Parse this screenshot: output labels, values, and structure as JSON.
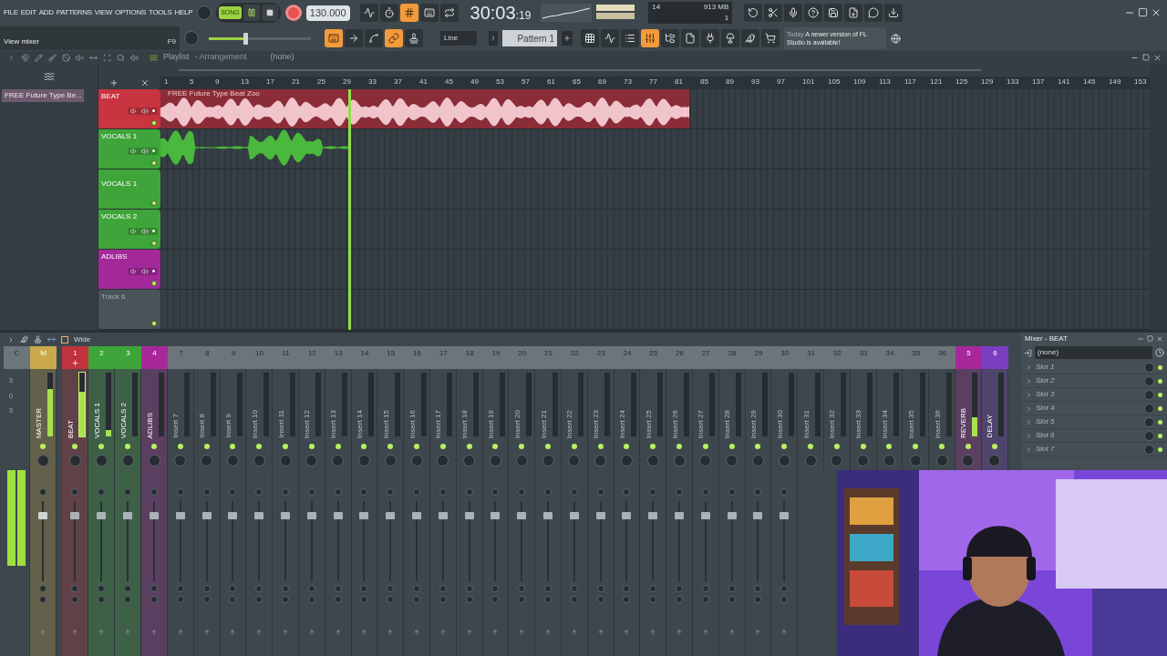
{
  "menu": [
    "FILE",
    "EDIT",
    "ADD",
    "PATTERNS",
    "VIEW",
    "OPTIONS",
    "TOOLS",
    "HELP"
  ],
  "transport": {
    "mode": "SONG",
    "tempo": "130.000",
    "time": "30:03",
    "time_small": ":19"
  },
  "top_tools": [
    {
      "on": false
    },
    {
      "on": false
    },
    {
      "on": true
    },
    {
      "on": false
    },
    {
      "on": false
    }
  ],
  "cpu": {
    "voices": "14",
    "memory": "913 MB",
    "polyphony": "1"
  },
  "hint": {
    "text": "View mixer",
    "shortcut": "F9"
  },
  "master_volume": {
    "level": 0.37
  },
  "edit_tools": [
    {
      "on": true
    },
    {
      "on": false
    },
    {
      "on": false
    },
    {
      "on": true
    },
    {
      "on": false
    }
  ],
  "snap": "Line",
  "pattern": "Pattern 1",
  "window_tools": [
    {
      "on": false
    },
    {
      "on": false
    },
    {
      "on": false
    },
    {
      "on": true
    },
    {
      "on": false
    },
    {
      "on": false
    },
    {
      "on": false
    },
    {
      "on": false
    },
    {
      "on": false
    },
    {
      "on": false
    }
  ],
  "news": {
    "date": "Today",
    "text": "A newer version of FL Studio is available!"
  },
  "playlist": {
    "title": "Playlist",
    "subtitle": "- Arrangement",
    "clip_source": "(none)",
    "browser_clip": "FREE Future Type Be...",
    "ruler": [
      "1",
      "5",
      "9",
      "13",
      "17",
      "21",
      "25",
      "29",
      "33",
      "37",
      "41",
      "45",
      "49",
      "53",
      "57",
      "61",
      "65",
      "69",
      "73",
      "77",
      "81",
      "85",
      "89",
      "93",
      "97",
      "101",
      "105",
      "109",
      "113",
      "117",
      "121",
      "125",
      "129",
      "133",
      "137",
      "141",
      "145",
      "149",
      "153"
    ],
    "playhead": {
      "level": 0.19
    },
    "tracks": [
      {
        "name": "BEAT",
        "kind": "track",
        "color": "#c8343f",
        "clip": {
          "title": "FREE Future Type Beat Zoo",
          "level": 0.535
        }
      },
      {
        "name": "VOCALS 1",
        "kind": "track",
        "color": "#3fa53a",
        "clip": {
          "level": 0.19
        }
      },
      {
        "name": "VOCALS 1",
        "kind": "lane",
        "color": "#3fa53a"
      },
      {
        "name": "VOCALS 2",
        "kind": "track",
        "color": "#3fa53a"
      },
      {
        "name": "ADLIBS",
        "kind": "track",
        "color": "#a3299a"
      },
      {
        "name": "Track 6",
        "kind": "empty"
      }
    ]
  },
  "mixer": {
    "preset": "Wide",
    "title": "Mixer - BEAT",
    "input": "(none)",
    "slots": [
      "Slot 1",
      "Slot 2",
      "Slot 3",
      "Slot 4",
      "Slot 5",
      "Slot 6",
      "Slot 7"
    ],
    "strips": [
      {
        "number": "C",
        "kind": "current",
        "scale": [
          "3",
          "0",
          "3"
        ],
        "level": 0.75,
        "selected": false
      },
      {
        "number": "M",
        "name": "MASTER",
        "kind": "master",
        "color": "#c9a94b",
        "level": 0.75,
        "selected": false
      },
      {
        "number": "1",
        "name": "BEAT",
        "kind": "insert",
        "color": "#c0323c",
        "level": 0.7,
        "selected": true
      },
      {
        "number": "2",
        "name": "VOCALS 1",
        "kind": "insert",
        "color": "#3ea53a",
        "level": 0.1,
        "selected": false
      },
      {
        "number": "3",
        "name": "VOCALS 2",
        "kind": "insert",
        "color": "#3ea53a",
        "level": 0,
        "selected": false
      },
      {
        "number": "4",
        "name": "ADLIBS",
        "kind": "insert",
        "color": "#a8289a",
        "level": 0,
        "selected": false
      },
      {
        "number": "7",
        "name": "Insert 7",
        "kind": "insert",
        "level": 0,
        "selected": false
      },
      {
        "number": "8",
        "name": "Insert 8",
        "kind": "insert",
        "level": 0,
        "selected": false
      },
      {
        "number": "9",
        "name": "Insert 9",
        "kind": "insert",
        "level": 0,
        "selected": false
      },
      {
        "number": "10",
        "name": "Insert 10",
        "kind": "insert",
        "level": 0,
        "selected": false
      },
      {
        "number": "11",
        "name": "Insert 11",
        "kind": "insert",
        "level": 0,
        "selected": false
      },
      {
        "number": "12",
        "name": "Insert 12",
        "kind": "insert",
        "level": 0,
        "selected": false
      },
      {
        "number": "13",
        "name": "Insert 13",
        "kind": "insert",
        "level": 0,
        "selected": false
      },
      {
        "number": "14",
        "name": "Insert 14",
        "kind": "insert",
        "level": 0,
        "selected": false
      },
      {
        "number": "15",
        "name": "Insert 15",
        "kind": "insert",
        "level": 0,
        "selected": false
      },
      {
        "number": "16",
        "name": "Insert 16",
        "kind": "insert",
        "level": 0,
        "selected": false
      },
      {
        "number": "17",
        "name": "Insert 17",
        "kind": "insert",
        "level": 0,
        "selected": false
      },
      {
        "number": "18",
        "name": "Insert 18",
        "kind": "insert",
        "level": 0,
        "selected": false
      },
      {
        "number": "19",
        "name": "Insert 19",
        "kind": "insert",
        "level": 0,
        "selected": false
      },
      {
        "number": "20",
        "name": "Insert 20",
        "kind": "insert",
        "level": 0,
        "selected": false
      },
      {
        "number": "21",
        "name": "Insert 21",
        "kind": "insert",
        "level": 0,
        "selected": false
      },
      {
        "number": "22",
        "name": "Insert 22",
        "kind": "insert",
        "level": 0,
        "selected": false
      },
      {
        "number": "23",
        "name": "Insert 23",
        "kind": "insert",
        "level": 0,
        "selected": false
      },
      {
        "number": "24",
        "name": "Insert 24",
        "kind": "insert",
        "level": 0,
        "selected": false
      },
      {
        "number": "25",
        "name": "Insert 25",
        "kind": "insert",
        "level": 0,
        "selected": false
      },
      {
        "number": "26",
        "name": "Insert 26",
        "kind": "insert",
        "level": 0,
        "selected": false
      },
      {
        "number": "27",
        "name": "Insert 27",
        "kind": "insert",
        "level": 0,
        "selected": false
      },
      {
        "number": "28",
        "name": "Insert 28",
        "kind": "insert",
        "level": 0,
        "selected": false
      },
      {
        "number": "29",
        "name": "Insert 29",
        "kind": "insert",
        "level": 0,
        "selected": false
      },
      {
        "number": "30",
        "name": "Insert 30",
        "kind": "insert",
        "level": 0,
        "selected": false
      },
      {
        "number": "31",
        "name": "Insert 31",
        "kind": "insert",
        "level": 0,
        "selected": false
      },
      {
        "number": "32",
        "name": "Insert 32",
        "kind": "insert",
        "level": 0,
        "selected": false
      },
      {
        "number": "33",
        "name": "Insert 33",
        "kind": "insert",
        "level": 0,
        "selected": false
      },
      {
        "number": "34",
        "name": "Insert 34",
        "kind": "insert",
        "level": 0,
        "selected": false
      },
      {
        "number": "35",
        "name": "Insert 35",
        "kind": "insert",
        "level": 0,
        "selected": false
      },
      {
        "number": "36",
        "name": "Insert 36",
        "kind": "insert",
        "level": 0,
        "selected": false
      },
      {
        "number": "5",
        "name": "REVERB",
        "kind": "insert",
        "color": "#a8289a",
        "level": 0.3,
        "selected": false
      },
      {
        "number": "6",
        "name": "DELAY",
        "kind": "insert",
        "color": "#7b3dc2",
        "level": 0,
        "selected": false
      }
    ]
  }
}
